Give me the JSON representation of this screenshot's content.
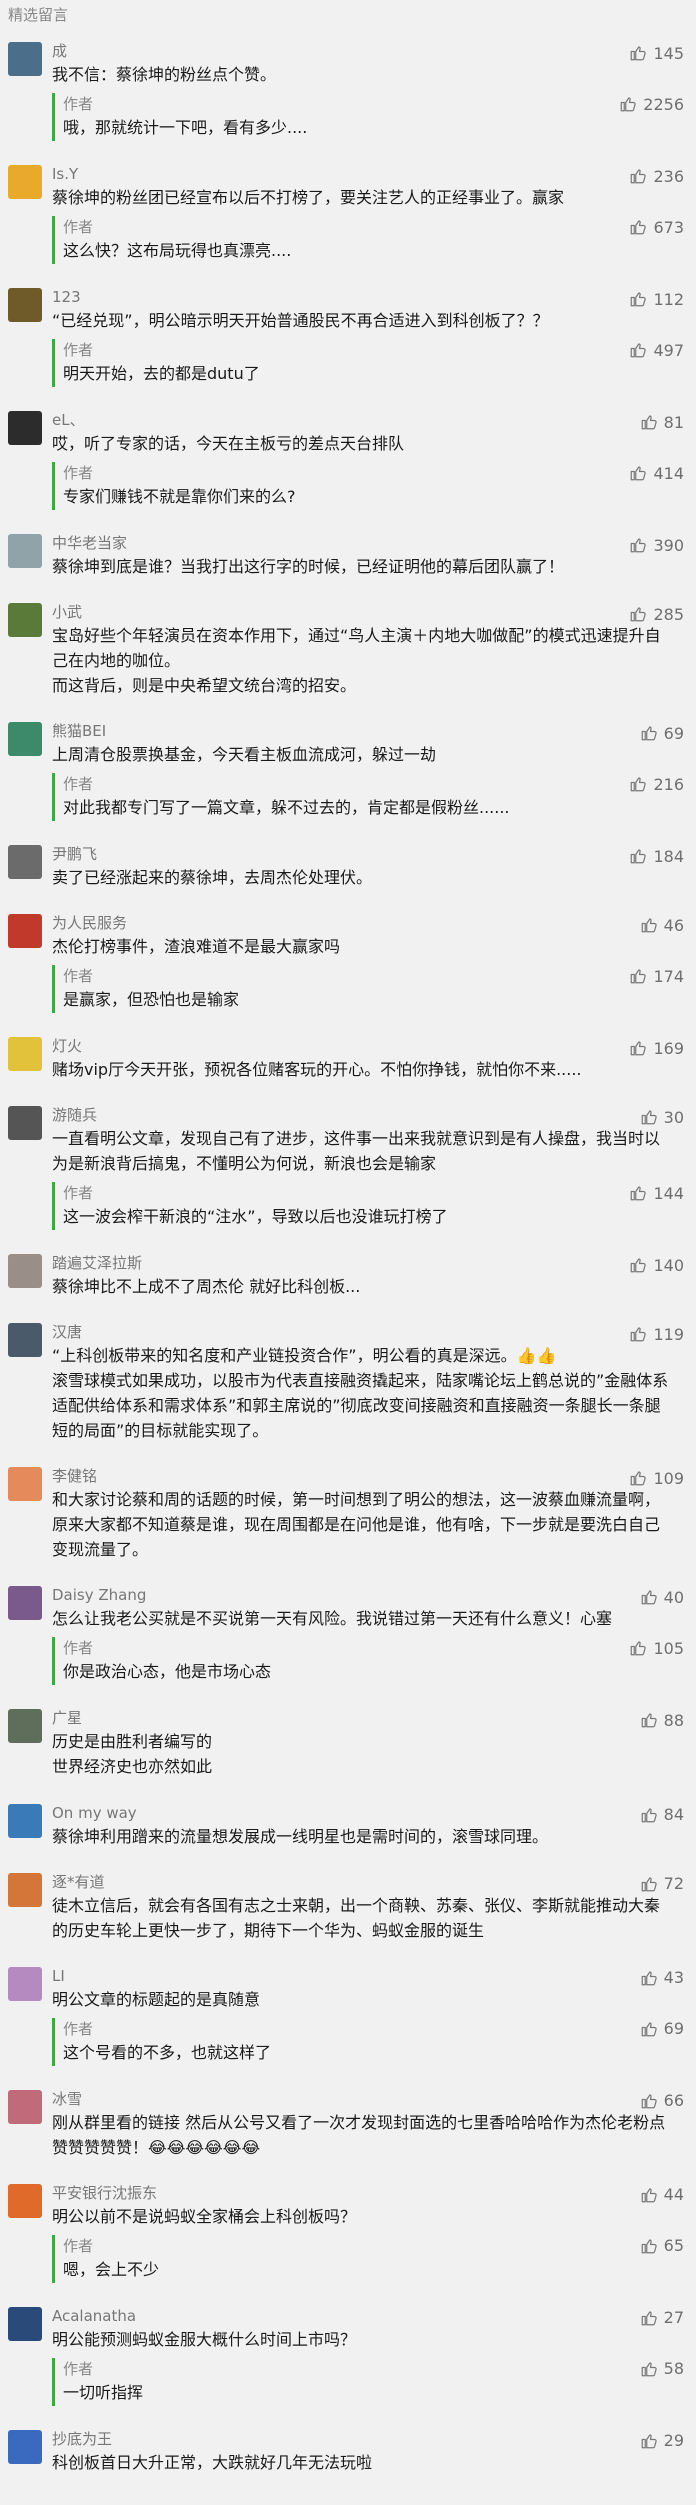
{
  "section_title": "精选留言",
  "reply_author_label": "作者",
  "comments": [
    {
      "nick": "成",
      "text": "我不信：蔡徐坤的粉丝点个赞。",
      "likes": "145",
      "avatar_color": "#4b6e8a",
      "reply": {
        "text": "哦，那就统计一下吧，看有多少....",
        "likes": "2256"
      }
    },
    {
      "nick": "Is.Y",
      "text": "蔡徐坤的粉丝团已经宣布以后不打榜了，要关注艺人的正经事业了。赢家",
      "likes": "236",
      "avatar_color": "#e9a92b",
      "reply": {
        "text": "这么快？这布局玩得也真漂亮....",
        "likes": "673"
      }
    },
    {
      "nick": "123",
      "text": "“已经兑现”，明公暗示明天开始普通股民不再合适进入到科创板了？？",
      "likes": "112",
      "avatar_color": "#6f5a2a",
      "reply": {
        "text": "明天开始，去的都是dutu了",
        "likes": "497"
      }
    },
    {
      "nick": "eL、",
      "text": "哎，听了专家的话，今天在主板亏的差点天台排队",
      "likes": "81",
      "avatar_color": "#2c2c2c",
      "reply": {
        "text": "专家们赚钱不就是靠你们来的么?",
        "likes": "414"
      }
    },
    {
      "nick": "中华老当家",
      "text": "蔡徐坤到底是谁？当我打出这行字的时候，已经证明他的幕后团队赢了！",
      "likes": "390",
      "avatar_color": "#8fa3a8",
      "reply": null
    },
    {
      "nick": "小武",
      "text": "宝岛好些个年轻演员在资本作用下，通过“鸟人主演＋内地大咖做配”的模式迅速提升自己在内地的咖位。\n而这背后，则是中央希望文统台湾的招安。",
      "likes": "285",
      "avatar_color": "#5a7a3a",
      "reply": null
    },
    {
      "nick": "熊猫BEI",
      "text": "上周清仓股票换基金，今天看主板血流成河，躲过一劫",
      "likes": "69",
      "avatar_color": "#3d8a6a",
      "reply": {
        "text": "对此我都专门写了一篇文章，躲不过去的，肯定都是假粉丝......",
        "likes": "216"
      }
    },
    {
      "nick": "尹鹏飞",
      "text": "卖了已经涨起来的蔡徐坤，去周杰伦处理伏。",
      "likes": "184",
      "avatar_color": "#6b6b6b",
      "reply": null
    },
    {
      "nick": "为人民服务",
      "text": "杰伦打榜事件，渣浪难道不是最大赢家吗",
      "likes": "46",
      "avatar_color": "#c0392b",
      "reply": {
        "text": "是赢家，但恐怕也是输家",
        "likes": "174"
      }
    },
    {
      "nick": "灯火",
      "text": "赌场vip厅今天开张，预祝各位赌客玩的开心。不怕你挣钱，就怕你不来.....",
      "likes": "169",
      "avatar_color": "#e2c23a",
      "reply": null
    },
    {
      "nick": "游随兵",
      "text": "一直看明公文章，发现自己有了进步，这件事一出来我就意识到是有人操盘，我当时以为是新浪背后搞鬼，不懂明公为何说，新浪也会是输家",
      "likes": "30",
      "avatar_color": "#555555",
      "reply": {
        "text": "这一波会榨干新浪的“注水”，导致以后也没谁玩打榜了",
        "likes": "144"
      }
    },
    {
      "nick": "踏遍艾泽拉斯",
      "text": "蔡徐坤比不上成不了周杰伦 就好比科创板...",
      "likes": "140",
      "avatar_color": "#9a8f88",
      "reply": null
    },
    {
      "nick": "汉唐",
      "text": "“上科创板带来的知名度和产业链投资合作”，明公看的真是深远。👍👍\n滚雪球模式如果成功，以股市为代表直接融资撬起来，陆家嘴论坛上鹤总说的”金融体系适配供给体系和需求体系”和郭主席说的”彻底改变间接融资和直接融资一条腿长一条腿短的局面”的目标就能实现了。",
      "likes": "119",
      "avatar_color": "#4a5a6a",
      "reply": null
    },
    {
      "nick": "李健铭",
      "text": "和大家讨论蔡和周的话题的时候，第一时间想到了明公的想法，这一波蔡血赚流量啊，原来大家都不知道蔡是谁，现在周围都是在问他是谁，他有啥，下一步就是要洗白自己变现流量了。",
      "likes": "109",
      "avatar_color": "#e58a5a",
      "reply": null
    },
    {
      "nick": "Daisy Zhang",
      "text": "怎么让我老公买就是不买说第一天有风险。我说错过第一天还有什么意义！心塞",
      "likes": "40",
      "avatar_color": "#7a5a8a",
      "reply": {
        "text": "你是政治心态，他是市场心态",
        "likes": "105"
      }
    },
    {
      "nick": "广星",
      "text": "历史是由胜利者编写的\n世界经济史也亦然如此",
      "likes": "88",
      "avatar_color": "#5f6e5a",
      "reply": null
    },
    {
      "nick": "On my way",
      "text": "蔡徐坤利用蹭来的流量想发展成一线明星也是需时间的，滚雪球同理。",
      "likes": "84",
      "avatar_color": "#3a7ab8",
      "reply": null
    },
    {
      "nick": "逐*有道",
      "text": "徒木立信后，就会有各国有志之士来朝，出一个商鞅、苏秦、张仪、李斯就能推动大秦的历史车轮上更快一步了，期待下一个华为、蚂蚁金服的诞生",
      "likes": "72",
      "avatar_color": "#d4763a",
      "reply": null
    },
    {
      "nick": "LI",
      "text": "明公文章的标题起的是真随意",
      "likes": "43",
      "avatar_color": "#b48ac0",
      "reply": {
        "text": "这个号看的不多，也就这样了",
        "likes": "69"
      }
    },
    {
      "nick": "冰雪",
      "text": "刚从群里看的链接 然后从公号又看了一次才发现封面选的七里香哈哈哈作为杰伦老粉点赞赞赞赞赞！😂😂😂😂😂😂",
      "likes": "66",
      "avatar_color": "#c06a7a",
      "reply": null
    },
    {
      "nick": "平安银行沈振东",
      "text": "明公以前不是说蚂蚁全家桶会上科创板吗？",
      "likes": "44",
      "avatar_color": "#e06a2a",
      "reply": {
        "text": "嗯，会上不少",
        "likes": "65"
      }
    },
    {
      "nick": "Acalanatha",
      "text": "明公能预测蚂蚁金服大概什么时间上市吗？",
      "likes": "27",
      "avatar_color": "#2a4a7a",
      "reply": {
        "text": "一切听指挥",
        "likes": "58"
      }
    },
    {
      "nick": "抄底为王",
      "text": "科创板首日大升正常，大跌就好几年无法玩啦",
      "likes": "29",
      "avatar_color": "#3a6ac0",
      "reply": null
    }
  ]
}
